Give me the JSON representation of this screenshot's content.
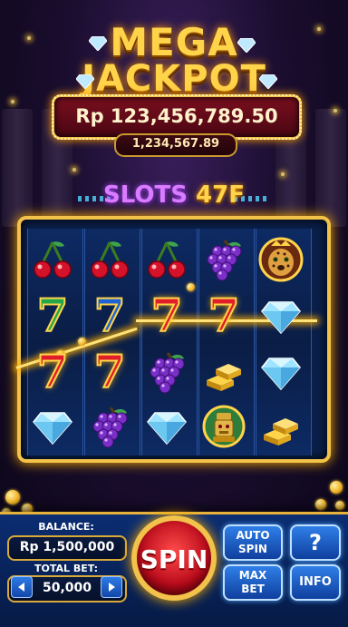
{
  "jackpot": {
    "title_line1": "MEGA",
    "title_line2": "JACKPOT",
    "amount": "Rp 123,456,789.50",
    "secondary_amount": "1,234,567.89"
  },
  "logo": {
    "word": "SLOTS",
    "number": "47F"
  },
  "reels": [
    [
      "cherries",
      "seven-green",
      "seven-red",
      "diamond"
    ],
    [
      "cherries",
      "seven-blue",
      "seven-red",
      "grapes"
    ],
    [
      "cherries",
      "seven-red",
      "grapes",
      "diamond"
    ],
    [
      "grapes",
      "seven-red",
      "gold-bars",
      "golden-idol"
    ],
    [
      "leopard",
      "diamond",
      "diamond",
      "gold-bars"
    ]
  ],
  "controls": {
    "balance_label": "BALANCE:",
    "balance_value": "Rp 1,500,000",
    "total_bet_label": "TOTAL BET:",
    "total_bet_value": "50,000",
    "spin_label": "SPIN",
    "auto_spin_label_1": "AUTO",
    "auto_spin_label_2": "SPIN",
    "max_bet_label_1": "MAX",
    "max_bet_label_2": "BET",
    "help_label": "?",
    "info_label": "INFO"
  },
  "colors": {
    "gold": "#f2c24a",
    "spin_red": "#b80a1a",
    "panel_blue": "#0b2d72"
  }
}
